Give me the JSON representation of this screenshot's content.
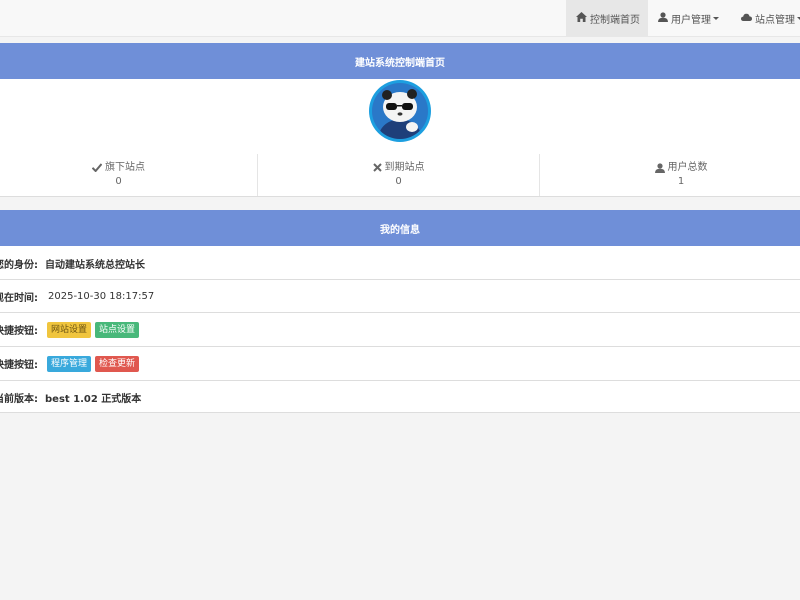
{
  "nav": {
    "home_label": "控制端首页",
    "users_label": "用户管理",
    "sites_label": "站点管理"
  },
  "dashboard": {
    "title": "建站系统控制端首页",
    "stats": [
      {
        "label": "旗下站点",
        "value": "0",
        "icon": "check-icon"
      },
      {
        "label": "到期站点",
        "value": "0",
        "icon": "close-icon"
      },
      {
        "label": "用户总数",
        "value": "1",
        "icon": "user-icon"
      }
    ]
  },
  "info": {
    "title": "我的信息",
    "identity_label": "您的身份:",
    "identity_value": "自动建站系统总控站长",
    "time_label": "现在时间:",
    "time_value": "2025-10-30 18:17:57",
    "quick1_label": "快捷按钮:",
    "quick1_buttons": [
      "网站设置",
      "站点设置"
    ],
    "quick2_label": "快捷按钮:",
    "quick2_buttons": [
      "程序管理",
      "检查更新"
    ],
    "version_label": "当前版本:",
    "version_value": "best 1.02 正式版本"
  },
  "colors": {
    "panel_heading": "#6f8fd8",
    "tag_warning": "#f0c53e",
    "tag_success": "#48b87a",
    "tag_info": "#39a9dc",
    "tag_danger": "#e0584f"
  }
}
